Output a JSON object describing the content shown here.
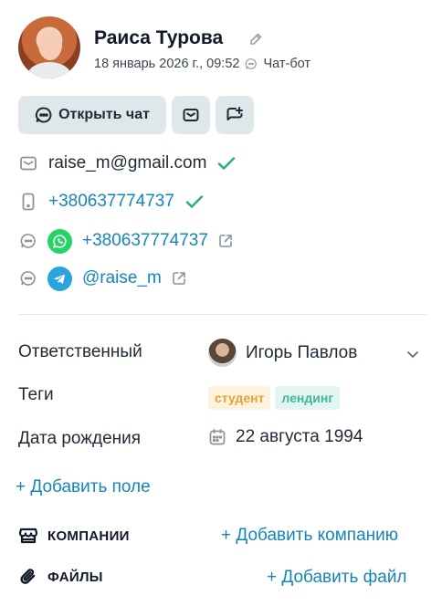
{
  "profile": {
    "name": "Раиса Турова",
    "date": "18 январь 2026 г., 09:52",
    "source": "Чат-бот",
    "icons": {
      "edit": "pencil-icon",
      "source": "chat-icon"
    }
  },
  "actions": {
    "open_chat": "Открыть чат",
    "email_icon": "envelope-icon",
    "add_chat_icon": "add-chat-icon"
  },
  "contacts": {
    "email": "raise_m@gmail.com",
    "phone": "+380637774737",
    "whatsapp": "+380637774737",
    "telegram": "@raise_m",
    "colors": {
      "link": "#1586b8",
      "verified": "#1db577",
      "whatsapp": "#25d366",
      "telegram": "#2aa3df"
    }
  },
  "fields": {
    "owner_label": "Ответственный",
    "owner_value": "Игорь Павлов",
    "tags_label": "Теги",
    "tags": [
      "студент",
      "лендинг"
    ],
    "birthday_label": "Дата рождения",
    "birthday_value": "22 августа 1994",
    "add_field": "+ Добавить поле"
  },
  "sections": {
    "companies_title": "КОМПАНИИ",
    "companies_add": "+ Добавить компанию",
    "files_title": "ФАЙЛЫ",
    "files_add": "+ Добавить файл"
  }
}
